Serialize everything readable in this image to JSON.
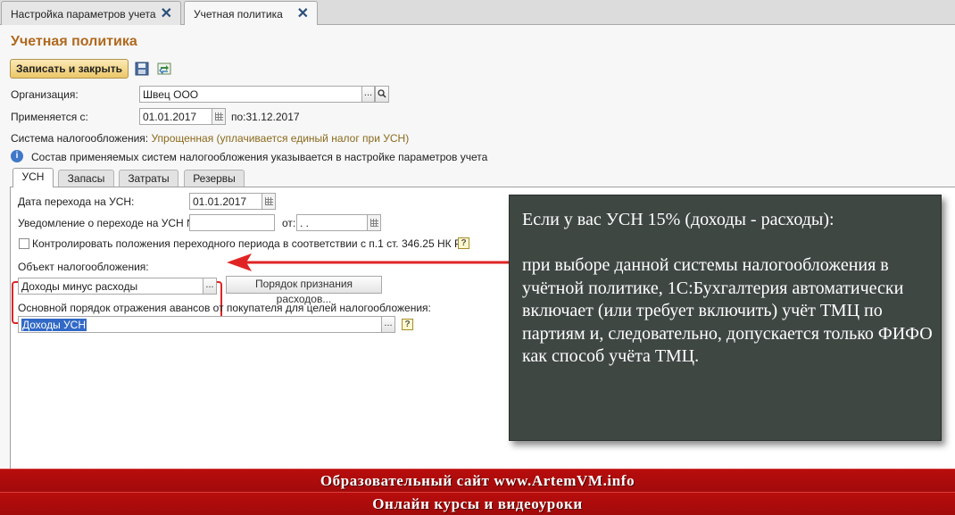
{
  "window_tabs": [
    {
      "label": "Настройка параметров учета",
      "active": false
    },
    {
      "label": "Учетная политика",
      "active": true
    }
  ],
  "form": {
    "title": "Учетная политика",
    "save_close_label": "Записать и закрыть",
    "organization_label": "Организация:",
    "organization_value": "Швец ООО",
    "applies_from_label": "Применяется с:",
    "applies_from_value": "01.01.2017",
    "applies_to_text": "по:31.12.2017",
    "tax_system_label": "Система налогообложения:",
    "tax_system_value": "Упрощенная (уплачивается единый налог при УСН)",
    "info_text": "Состав применяемых систем налогообложения указывается в настройке параметров учета"
  },
  "form_tabs": [
    "УСН",
    "Запасы",
    "Затраты",
    "Резервы"
  ],
  "usn": {
    "transition_date_label": "Дата перехода на УСН:",
    "transition_date_value": "01.01.2017",
    "notice_label": "Уведомление о переходе на УСН №:",
    "notice_number_value": "",
    "notice_from_label": "от:",
    "notice_from_value": " .  .",
    "control_checkbox_label": "Контролировать положения переходного периода в соответствии с п.1 ст. 346.25 НК РФ",
    "control_checked": false,
    "tax_object_label": "Объект налогообложения:",
    "tax_object_value": "Доходы минус расходы",
    "expense_order_button": "Порядок признания расходов...",
    "advance_label": "Основной порядок отражения авансов от покупателя для целей налогообложения:",
    "advance_value": "Доходы УСН"
  },
  "callout": {
    "heading": "Если у вас УСН 15% (доходы - расходы):",
    "body": "при выборе данной системы налогообложения в учётной политике, 1С:Бухгалтерия автоматически включает (или требует включить) учёт ТМЦ по партиям и, следовательно, допускается только ФИФО как способ учёта ТМЦ."
  },
  "banners": {
    "line1": "Образовательный сайт www.ArtemVM.info",
    "line2": "Онлайн курсы и видеоуроки"
  },
  "colors": {
    "title": "#b0691e",
    "highlight_red": "#e02424",
    "callout_bg": "#3f4743",
    "banner_red": "#b80d0d"
  },
  "icons": [
    "close-icon",
    "save-disk-icon",
    "reread-icon",
    "ellipsis-icon",
    "search-icon",
    "calendar-icon",
    "info-icon",
    "help-icon",
    "arrow-icon"
  ]
}
